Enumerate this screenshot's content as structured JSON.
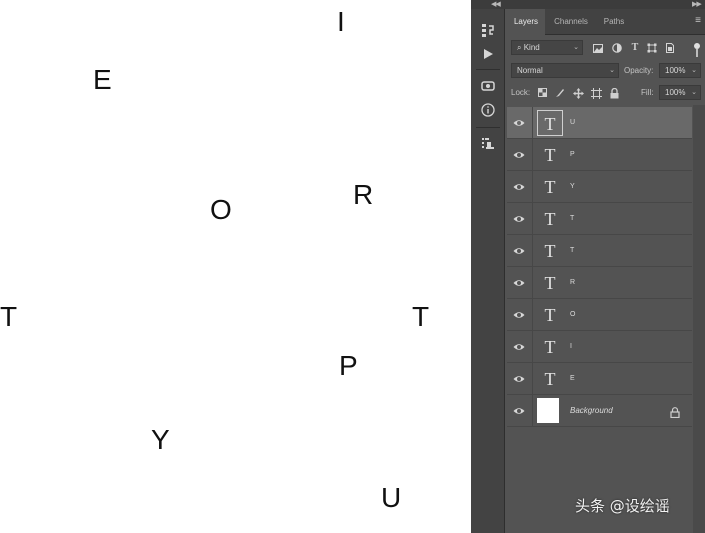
{
  "canvas": {
    "letters": [
      "I",
      "E",
      "R",
      "O",
      "T",
      "T",
      "P",
      "Y",
      "U"
    ]
  },
  "tabs": [
    {
      "label": "Layers",
      "active": true
    },
    {
      "label": "Channels",
      "active": false
    },
    {
      "label": "Paths",
      "active": false
    }
  ],
  "filter": {
    "kind_label": "Kind",
    "icons": [
      "search-icon",
      "pixel-filter-icon",
      "adjustment-filter-icon",
      "type-filter-icon",
      "shape-filter-icon",
      "smart-object-filter-icon"
    ]
  },
  "blend": {
    "mode": "Normal",
    "opacity_label": "Opacity:",
    "opacity_value": "100%"
  },
  "lock": {
    "label": "Lock:",
    "fill_label": "Fill:",
    "fill_value": "100%"
  },
  "layers": [
    {
      "name": "U",
      "kind": "text",
      "selected": true
    },
    {
      "name": "P",
      "kind": "text",
      "selected": false
    },
    {
      "name": "Y",
      "kind": "text",
      "selected": false
    },
    {
      "name": "T",
      "kind": "text",
      "selected": false
    },
    {
      "name": "T",
      "kind": "text",
      "selected": false
    },
    {
      "name": "R",
      "kind": "text",
      "selected": false
    },
    {
      "name": "O",
      "kind": "text",
      "selected": false
    },
    {
      "name": "I",
      "kind": "text",
      "selected": false
    },
    {
      "name": "E",
      "kind": "text",
      "selected": false
    },
    {
      "name": "Background",
      "kind": "background",
      "selected": false
    }
  ],
  "thumb_glyph": "T",
  "watermark": "头条 @设绘谣",
  "colors": {
    "panel_bg": "#535353",
    "selected_row": "#696969",
    "canvas_bg": "#ffffff"
  }
}
